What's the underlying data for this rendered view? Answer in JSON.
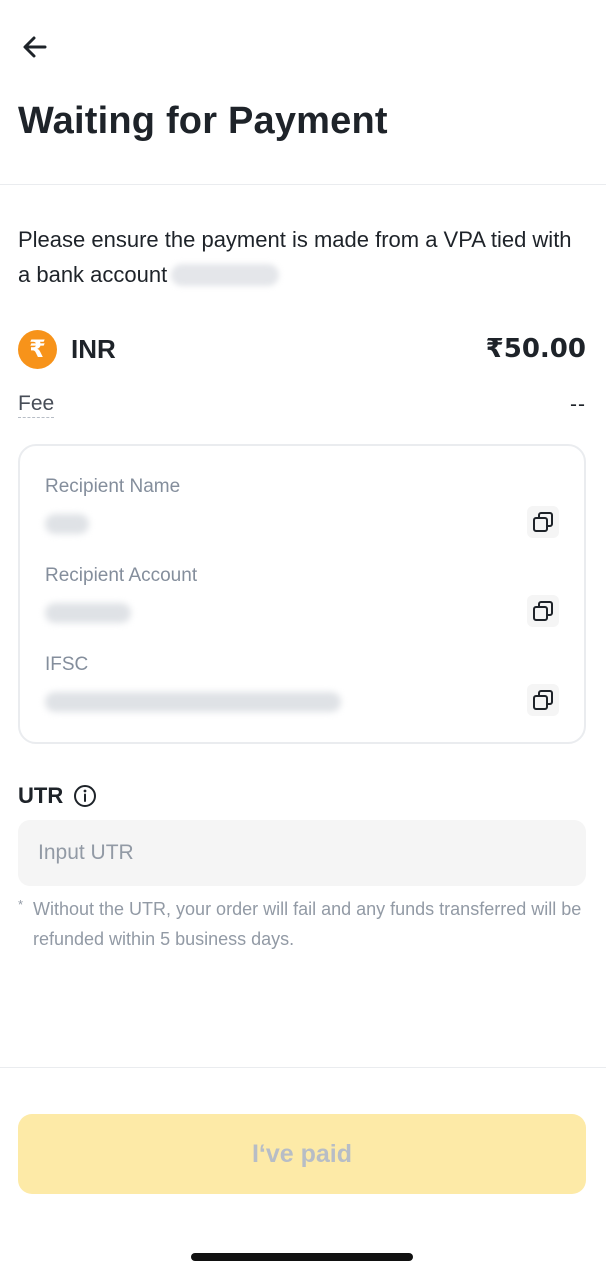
{
  "header": {
    "back_icon": "arrow-left-icon",
    "title": "Waiting for Payment"
  },
  "notice": {
    "text": "Please ensure the payment is made from a VPA tied with a bank account"
  },
  "currency": {
    "icon": "rupee-icon",
    "icon_glyph": "₹",
    "icon_color": "#f7931a",
    "code": "INR",
    "amount": "₹50.00"
  },
  "fee": {
    "label": "Fee",
    "value": "--"
  },
  "recipient": {
    "fields": [
      {
        "label": "Recipient Name",
        "copy_icon": "copy-icon"
      },
      {
        "label": "Recipient Account",
        "copy_icon": "copy-icon"
      },
      {
        "label": "IFSC",
        "copy_icon": "copy-icon"
      }
    ]
  },
  "utr": {
    "label": "UTR",
    "info_icon": "info-icon",
    "placeholder": "Input UTR",
    "value": "",
    "note_marker": "*",
    "note": "Without the UTR, your order will fail and any funds transferred will be refunded within 5 business days."
  },
  "footer": {
    "button_label": "I‘ve paid",
    "button_color": "#fdeaa7"
  }
}
